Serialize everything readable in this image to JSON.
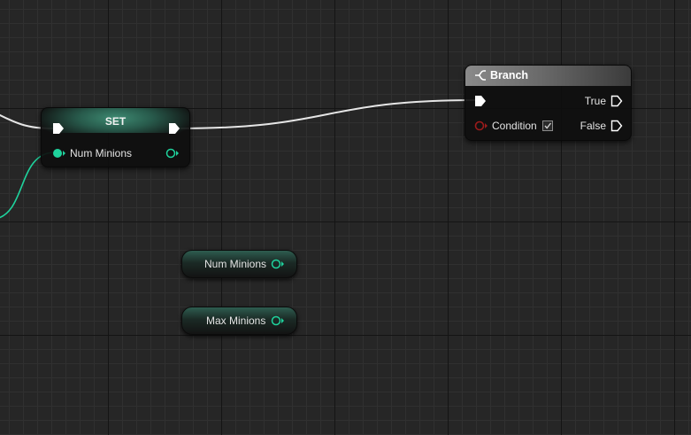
{
  "graph": {
    "background_color": "#262626",
    "wire_exec_color": "#e6e6e6",
    "wire_int_color": "#1fd39d"
  },
  "set_node": {
    "title": "SET",
    "input_pin_label": "Num Minions",
    "accent_color": "#2f6e5b"
  },
  "branch_node": {
    "title": "Branch",
    "icon": "branch-icon",
    "true_label": "True",
    "false_label": "False",
    "condition_label": "Condition",
    "condition_checked": true,
    "condition_pin_color": "#9b1b1b"
  },
  "getters": [
    {
      "label": "Num Minions"
    },
    {
      "label": "Max Minions"
    }
  ]
}
